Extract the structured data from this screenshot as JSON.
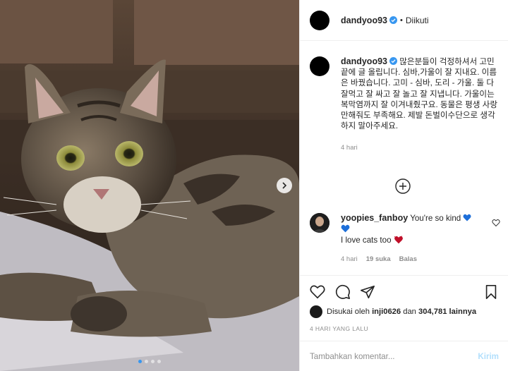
{
  "header": {
    "username": "dandyoo93",
    "separator": "•",
    "follow_status": "Diikuti"
  },
  "caption": {
    "username": "dandyoo93",
    "text": "많은분들이 걱정하셔서 고민끝에 글 올립니다. 심바,가울이 잘 지내요. 이름은 바꿨습니다. 고미 - 심바, 도리 - 가울. 둘 다 잘먹고 잘 싸고 잘 놀고 잘 지냅니다. 가울이는 복막염까지 잘 이겨내줬구요. 동물은 평생 사랑만해줘도 부족해요. 제발 돈벌이수단으로 생각하지 말아주세요.",
    "time": "4 hari"
  },
  "comment": {
    "username": "yoopies_fanboy",
    "text_line1": "You're so kind",
    "text_line2": "I love cats too",
    "time": "4 hari",
    "likes": "19 suka",
    "reply": "Balas"
  },
  "likes": {
    "prefix": "Disukai oleh",
    "user": "inji0626",
    "middle": "dan",
    "count": "304,781 lainnya"
  },
  "post_date": "4 HARI YANG LALU",
  "add_comment": {
    "placeholder": "Tambahkan komentar...",
    "post_label": "Kirim"
  },
  "carousel": {
    "total": 4,
    "active_index": 0
  },
  "colors": {
    "verified": "#3897f0",
    "heart_blue": "#1e6fd9",
    "heart_red": "#c0102a",
    "muted_text": "#8e8e8e",
    "post_button": "#b2dffc"
  }
}
